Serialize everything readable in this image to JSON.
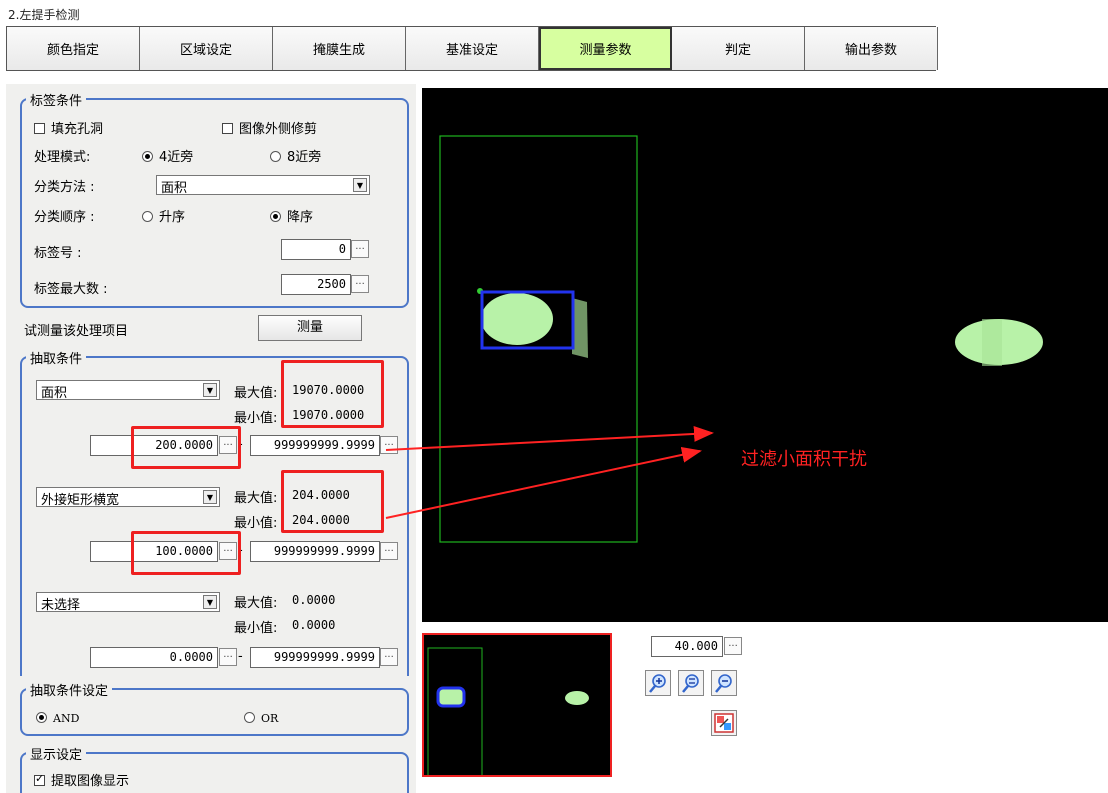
{
  "caption": "2.左提手检测",
  "tabs": [
    "颜色指定",
    "区域设定",
    "掩膜生成",
    "基准设定",
    "测量参数",
    "判定",
    "输出参数"
  ],
  "label_cond": {
    "title": "标签条件",
    "fill_holes": "填充孔洞",
    "trim_outside": "图像外侧修剪",
    "proc_mode_label": "处理模式:",
    "mode4": "4近旁",
    "mode8": "8近旁",
    "sort_method_label": "分类方法 :",
    "sort_method_value": "面积",
    "sort_order_label": "分类顺序 :",
    "asc": "升序",
    "desc": "降序",
    "label_no_label": "标签号 :",
    "label_no_value": "0",
    "label_max_label": "标签最大数 :",
    "label_max_value": "2500"
  },
  "test_measure": {
    "label": "试测量该处理项目",
    "button": "测量"
  },
  "extract_cond": {
    "title": "抽取条件",
    "max_label": "最大值:",
    "min_label": "最小值:",
    "items": [
      {
        "select": "面积",
        "max": "19070.0000",
        "min": "19070.0000",
        "low": "200.0000",
        "high": "999999999.9999"
      },
      {
        "select": "外接矩形横宽",
        "max": "204.0000",
        "min": "204.0000",
        "low": "100.0000",
        "high": "999999999.9999"
      },
      {
        "select": "未选择",
        "max": "0.0000",
        "min": "0.0000",
        "low": "0.0000",
        "high": "999999999.9999"
      }
    ]
  },
  "extract_setting": {
    "title": "抽取条件设定",
    "and": "AND",
    "or": "OR"
  },
  "display_setting": {
    "title": "显示设定",
    "show_extract": "提取图像显示"
  },
  "annotation": "过滤小面积干扰",
  "zoom_value": "40.000",
  "colors": {
    "accent_tab": "#d7ffa0",
    "group_border": "#4d77c8",
    "highlight_red": "#ee2020",
    "annotation_red": "#ff2222"
  }
}
